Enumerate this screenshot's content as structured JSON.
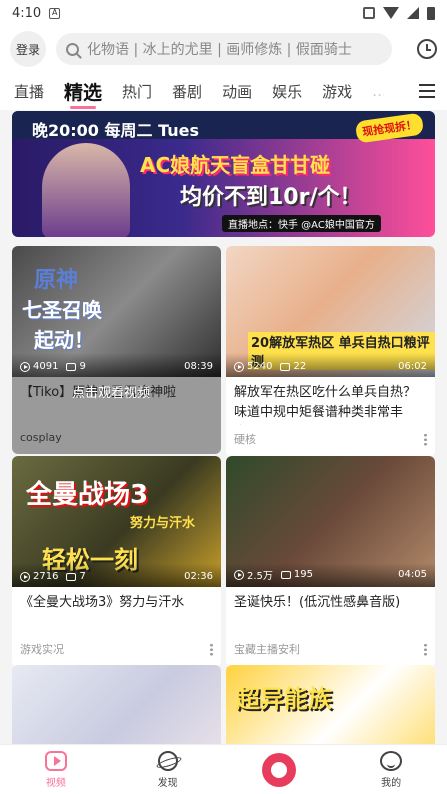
{
  "status_bar": {
    "time": "4:10",
    "notif_letter": "A"
  },
  "header": {
    "login_label": "登录",
    "search_placeholder": "化物语 | 冰上的尤里 | 画师修炼 | 假面骑士"
  },
  "tabs": [
    {
      "label": "直播",
      "active": false
    },
    {
      "label": "精选",
      "active": true
    },
    {
      "label": "热门",
      "active": false
    },
    {
      "label": "番剧",
      "active": false
    },
    {
      "label": "动画",
      "active": false
    },
    {
      "label": "娱乐",
      "active": false
    },
    {
      "label": "游戏",
      "active": false
    },
    {
      "label": "…",
      "active": false
    }
  ],
  "banner": {
    "time_text": "晚20:00 每周二 Tues",
    "headline": "AC娘航天盲盒甘甘碰",
    "price_text": "均价不到10r/个！",
    "location_text": "直播地点：快手 @AC娘中国官方",
    "badge": "现抢现拆！"
  },
  "videos": [
    {
      "views": "4091",
      "danmaku": "9",
      "duration": "08:39",
      "title": "【Tiko】原神七圣召唤神啦",
      "tip": "点击观看视频",
      "category": "cosplay",
      "overlay": [
        "原神",
        "七圣召唤",
        "起动！"
      ]
    },
    {
      "views": "5240",
      "danmaku": "22",
      "duration": "06:02",
      "title": "解放军在热区吃什么单兵自热？味道中规中矩餐谱种类非常丰富...",
      "category": "硬核",
      "overlay": [
        "20解放军热区 单兵自热口粮评测"
      ]
    },
    {
      "views": "2716",
      "danmaku": "7",
      "duration": "02:36",
      "title": "《全曼大战场3》努力与汗水",
      "category": "游戏实况",
      "overlay": [
        "全曼战场3",
        "努力与汗水",
        "轻松一刻"
      ]
    },
    {
      "views": "2.5万",
      "danmaku": "195",
      "duration": "04:05",
      "title": "圣诞快乐！(低沉性感鼻音版)",
      "category": "宝藏主播安利"
    },
    {
      "views": "",
      "danmaku": "",
      "duration": "",
      "title": "",
      "category": ""
    },
    {
      "views": "",
      "danmaku": "",
      "duration": "",
      "title": "",
      "category": "",
      "overlay": [
        "超异能族"
      ]
    }
  ],
  "bottom_nav": [
    {
      "label": "视频",
      "active": true
    },
    {
      "label": "发现",
      "active": false
    },
    {
      "label": "",
      "active": false
    },
    {
      "label": "我的",
      "active": false
    }
  ]
}
